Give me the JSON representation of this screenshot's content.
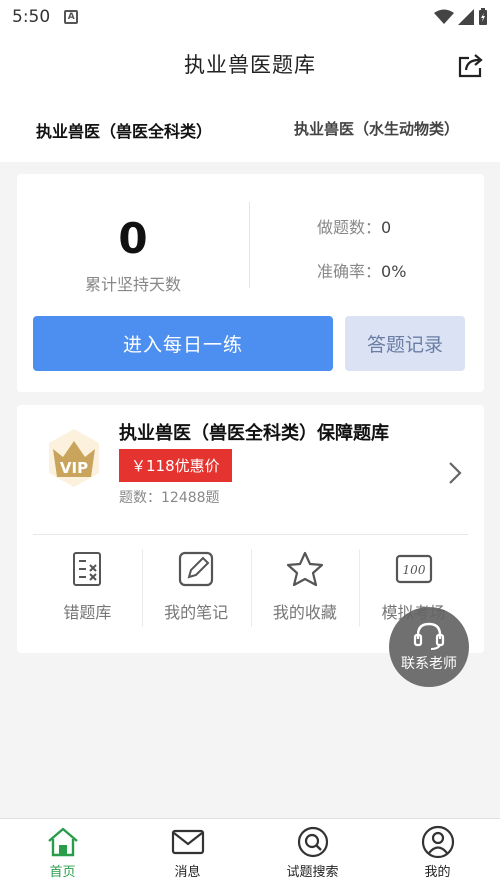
{
  "status_bar": {
    "time": "5:50",
    "notification_letter": "A"
  },
  "header": {
    "title": "执业兽医题库",
    "share_icon": "share-icon"
  },
  "tabs": [
    {
      "label": "执业兽医（兽医全科类）",
      "active": true
    },
    {
      "label": "执业兽医（水生动物类）",
      "active": false
    }
  ],
  "stats": {
    "days_value": "0",
    "days_label": "累计坚持天数",
    "done_label": "做题数：",
    "done_value": "0",
    "accuracy_label": "准确率：",
    "accuracy_value": "0%",
    "daily_button": "进入每日一练",
    "record_button": "答题记录"
  },
  "bank": {
    "vip_text": "VIP",
    "title": "执业兽医（兽医全科类）保障题库",
    "price": "￥118优惠价",
    "count": "题数：12488题",
    "tools": [
      {
        "label": "错题库",
        "icon": "wrong-questions-icon"
      },
      {
        "label": "我的笔记",
        "icon": "notes-icon"
      },
      {
        "label": "我的收藏",
        "icon": "star-icon"
      },
      {
        "label": "模拟考场",
        "icon": "exam-icon"
      }
    ]
  },
  "contact": {
    "label": "联系老师",
    "icon": "headset-icon"
  },
  "bottom_nav": [
    {
      "label": "首页",
      "icon": "home-icon",
      "active": true
    },
    {
      "label": "消息",
      "icon": "mail-icon",
      "active": false
    },
    {
      "label": "试题搜索",
      "icon": "search-icon",
      "active": false
    },
    {
      "label": "我的",
      "icon": "profile-icon",
      "active": false
    }
  ],
  "colors": {
    "primary": "#4d8ff0",
    "price": "#e5342f",
    "active_nav": "#2a9d4a",
    "vip_gold": "#c9a45c"
  }
}
